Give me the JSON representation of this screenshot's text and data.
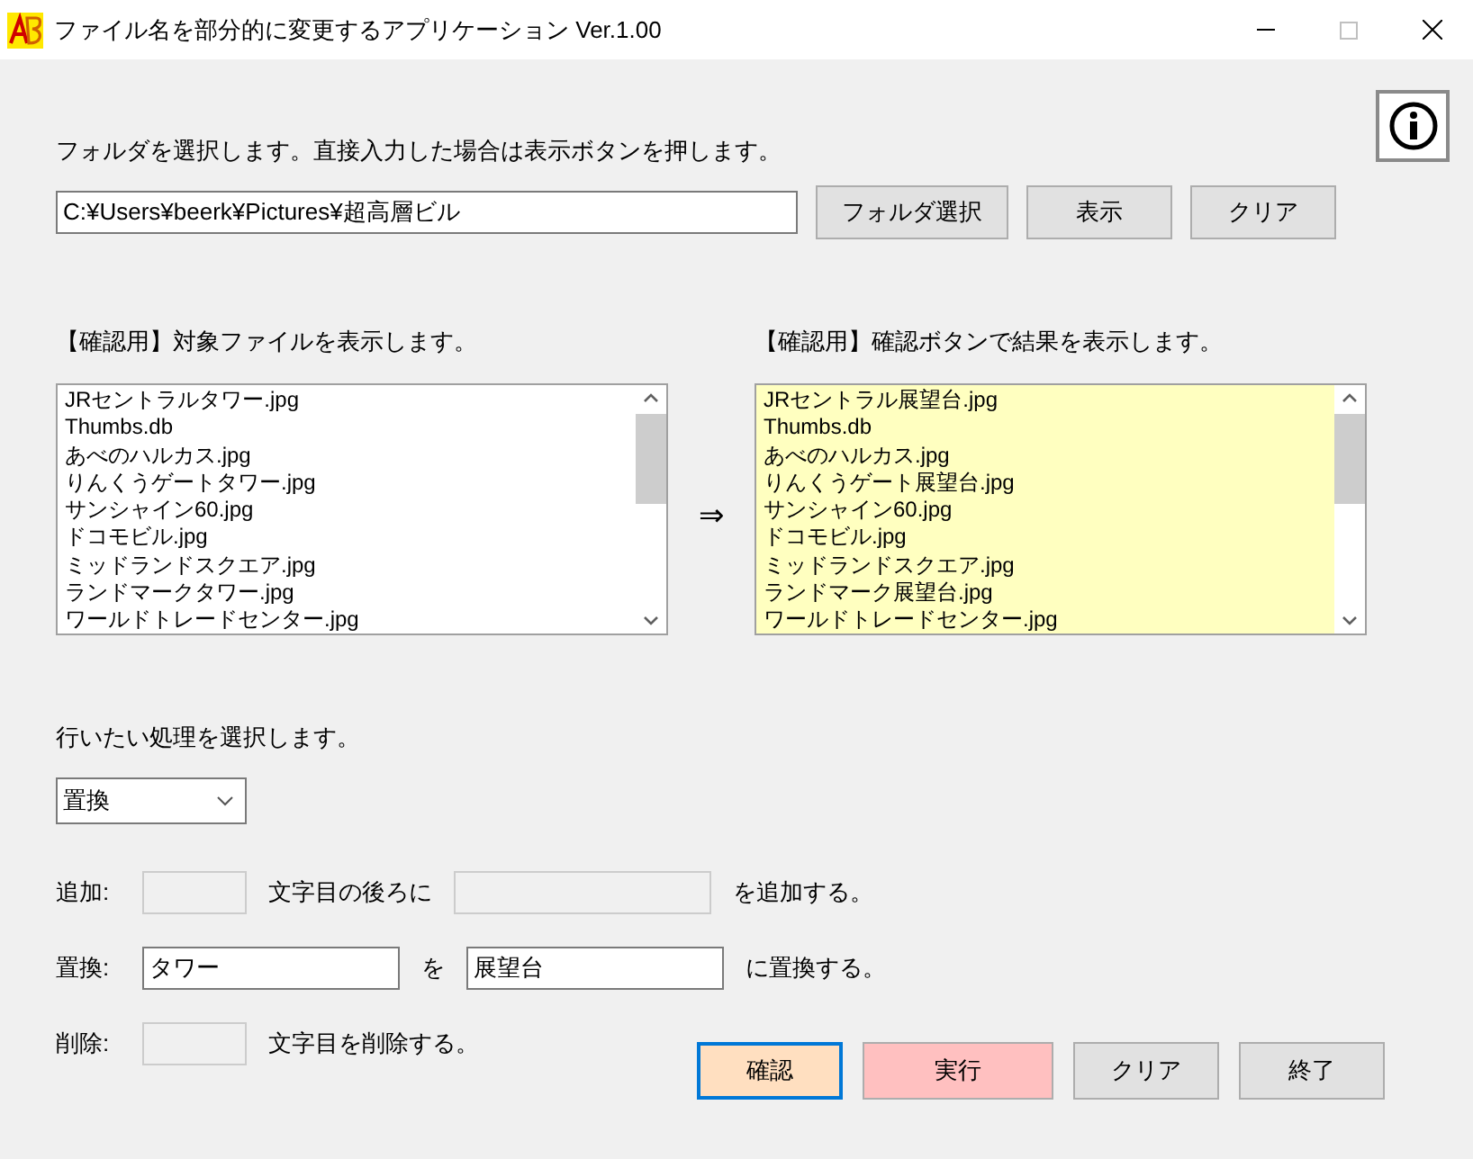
{
  "window": {
    "title": "ファイル名を部分的に変更するアプリケーション Ver.1.00"
  },
  "folder": {
    "instruction": "フォルダを選択します。直接入力した場合は表示ボタンを押します。",
    "path": "C:¥Users¥beerk¥Pictures¥超高層ビル",
    "buttons": [
      "フォルダ選択",
      "表示",
      "クリア"
    ]
  },
  "source_list": {
    "label": "【確認用】対象ファイルを表示します。",
    "items": [
      "JRセントラルタワー.jpg",
      "Thumbs.db",
      "あべのハルカス.jpg",
      "りんくうゲートタワー.jpg",
      "サンシャイン60.jpg",
      "ドコモビル.jpg",
      "ミッドランドスクエア.jpg",
      "ランドマークタワー.jpg",
      "ワールドトレードセンター.jpg"
    ]
  },
  "arrow": "⇒",
  "result_list": {
    "label": "【確認用】確認ボタンで結果を表示します。",
    "items": [
      "JRセントラル展望台.jpg",
      "Thumbs.db",
      "あべのハルカス.jpg",
      "りんくうゲート展望台.jpg",
      "サンシャイン60.jpg",
      "ドコモビル.jpg",
      "ミッドランドスクエア.jpg",
      "ランドマーク展望台.jpg",
      "ワールドトレードセンター.jpg"
    ]
  },
  "operation": {
    "label": "行いたい処理を選択します。",
    "value": "置換"
  },
  "rows": [
    {
      "label": "追加:",
      "parts": [
        {
          "kind": "short-field",
          "disabled": true
        },
        {
          "kind": "text",
          "text": "文字目の後ろに"
        },
        {
          "kind": "long-field",
          "disabled": true
        },
        {
          "kind": "text",
          "text": "を追加する。"
        }
      ]
    },
    {
      "label": "置換:",
      "parts": [
        {
          "kind": "long-field",
          "disabled": false,
          "value": "タワー"
        },
        {
          "kind": "text",
          "text": "を"
        },
        {
          "kind": "long-field",
          "disabled": false,
          "value": "展望台"
        },
        {
          "kind": "text",
          "text": "に置換する。"
        }
      ]
    },
    {
      "label": "削除:",
      "parts": [
        {
          "kind": "short-field",
          "disabled": true
        },
        {
          "kind": "text",
          "text": "文字目を削除する。"
        }
      ]
    }
  ],
  "actions": [
    {
      "label": "確認",
      "kind": "confirm"
    },
    {
      "label": "実行",
      "kind": "execute"
    },
    {
      "label": "クリア",
      "kind": "normal"
    },
    {
      "label": "終了",
      "kind": "normal"
    }
  ]
}
